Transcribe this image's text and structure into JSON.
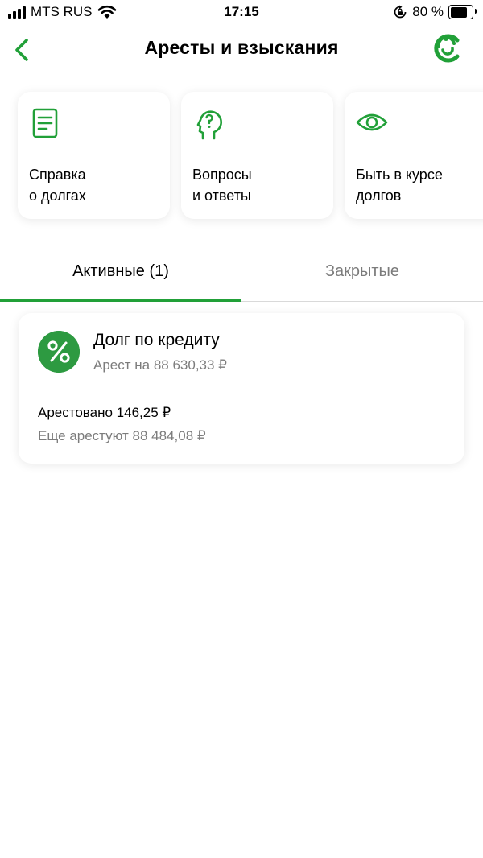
{
  "status_bar": {
    "carrier": "MTS RUS",
    "time": "17:15",
    "battery_percent": "80 %",
    "battery_level": 0.8
  },
  "nav": {
    "title": "Аресты и взыскания"
  },
  "quick_actions": [
    {
      "label": "Справка\nо долгах",
      "icon": "document-icon"
    },
    {
      "label": "Вопросы\nи ответы",
      "icon": "question-head-icon"
    },
    {
      "label": "Быть в курсе\nдолгов",
      "icon": "eye-icon"
    }
  ],
  "tabs": [
    {
      "label": "Активные (1)",
      "active": true
    },
    {
      "label": "Закрытые",
      "active": false
    }
  ],
  "debt": {
    "title": "Долг по кредиту",
    "subtitle": "Арест на 88 630,33 ₽",
    "arrested": "Арестовано 146,25 ₽",
    "remaining": "Еще арестуют 88 484,08 ₽",
    "icon": "percent-icon"
  },
  "colors": {
    "accent": "#21a038",
    "icon_bg": "#2d9a41",
    "muted_text": "#7c7c7c"
  }
}
